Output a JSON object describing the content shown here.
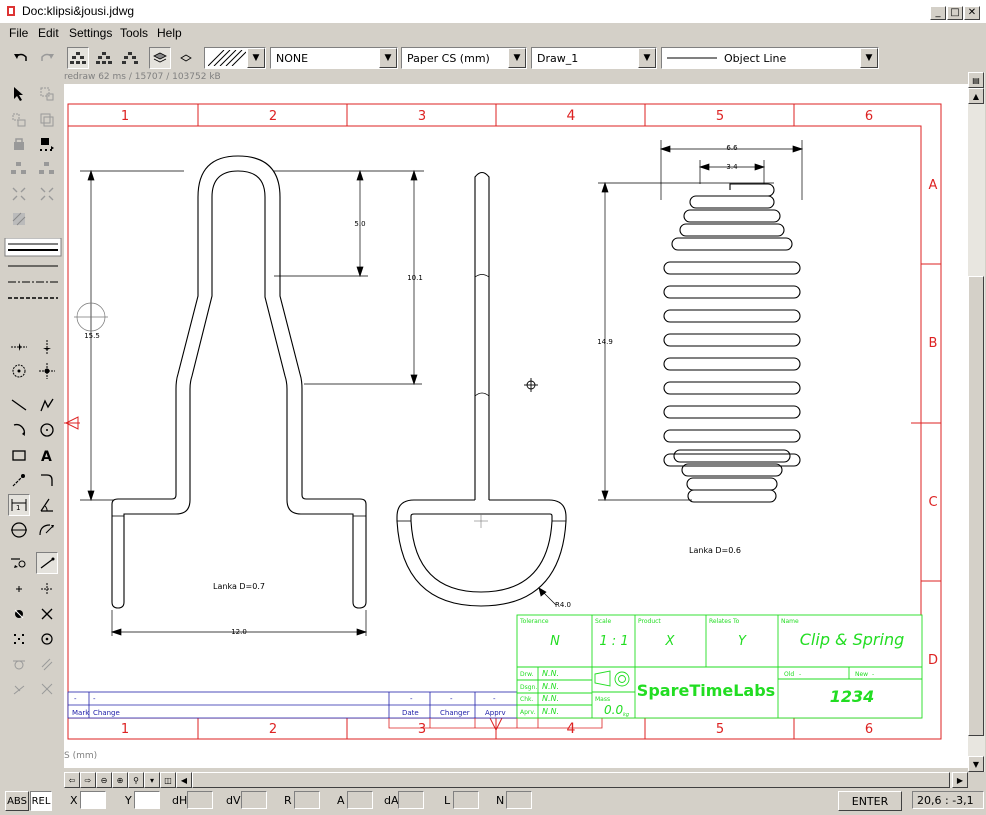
{
  "window": {
    "title": "Doc:klipsi&jousi.jdwg"
  },
  "menu": [
    "File",
    "Edit",
    "Settings",
    "Tools",
    "Help"
  ],
  "toolbar": {
    "pattern_select": "",
    "fill_select": "NONE",
    "coord_system_select": "Paper CS (mm)",
    "layer_select": "Draw_1",
    "linetype_select": "Object Line"
  },
  "status_top": "redraw 62 ms / 15707 / 103752 kB",
  "canvas_units_label": "S (mm)",
  "border": {
    "columns": [
      "1",
      "2",
      "3",
      "4",
      "5",
      "6"
    ],
    "rows": [
      "A",
      "B",
      "C",
      "D"
    ]
  },
  "dimensions": {
    "clip_height": "15.5",
    "clip_upper": "5.0",
    "clip_total": "10.1",
    "clip_width": "12.0",
    "clip_note": "Lanka D=0.7",
    "spring_outer": "6.6",
    "spring_inner": "3.4",
    "spring_height": "14.9",
    "spring_note": "Lanka D=0.6",
    "radius": "R4.0"
  },
  "title_block": {
    "tolerance_label": "Tolerance",
    "tolerance_value": "N",
    "scale_label": "Scale",
    "scale_value": "1 : 1",
    "product_label": "Product",
    "product_value": "X",
    "relates_label": "Relates To",
    "relates_value": "Y",
    "name_label": "Name",
    "name_value": "Clip & Spring",
    "drw_label": "Drw.",
    "drw_value": "N.N.",
    "dsgn_label": "Dsgn.",
    "dsgn_value": "N.N.",
    "chk_label": "Chk.",
    "chk_value": "N.N.",
    "aprv_label": "Aprv.",
    "aprv_value": "N.N.",
    "mass_label": "Mass",
    "mass_value": "0.0",
    "mass_unit": "kg",
    "company": "SpareTimeLabs",
    "old_label": "Old",
    "old_value": "-",
    "new_label": "New",
    "new_value": "-",
    "drawing_number": "1234"
  },
  "revision_table": {
    "mark_label": "Mark",
    "change_label": "Change",
    "date_label": "Date",
    "changer_label": "Changer",
    "apprv_label": "Apprv",
    "dash": "-"
  },
  "bottom": {
    "abs": "ABS",
    "rel": "REL",
    "x": "X",
    "y": "Y",
    "dh": "dH",
    "dv": "dV",
    "r": "R",
    "a": "A",
    "da": "dA",
    "l": "L",
    "n": "N",
    "enter": "ENTER",
    "coords": "20,6 : -3,1"
  },
  "colors": {
    "border_red": "#dd2222",
    "title_green": "#22dd22",
    "rev_blue": "#2222aa"
  }
}
